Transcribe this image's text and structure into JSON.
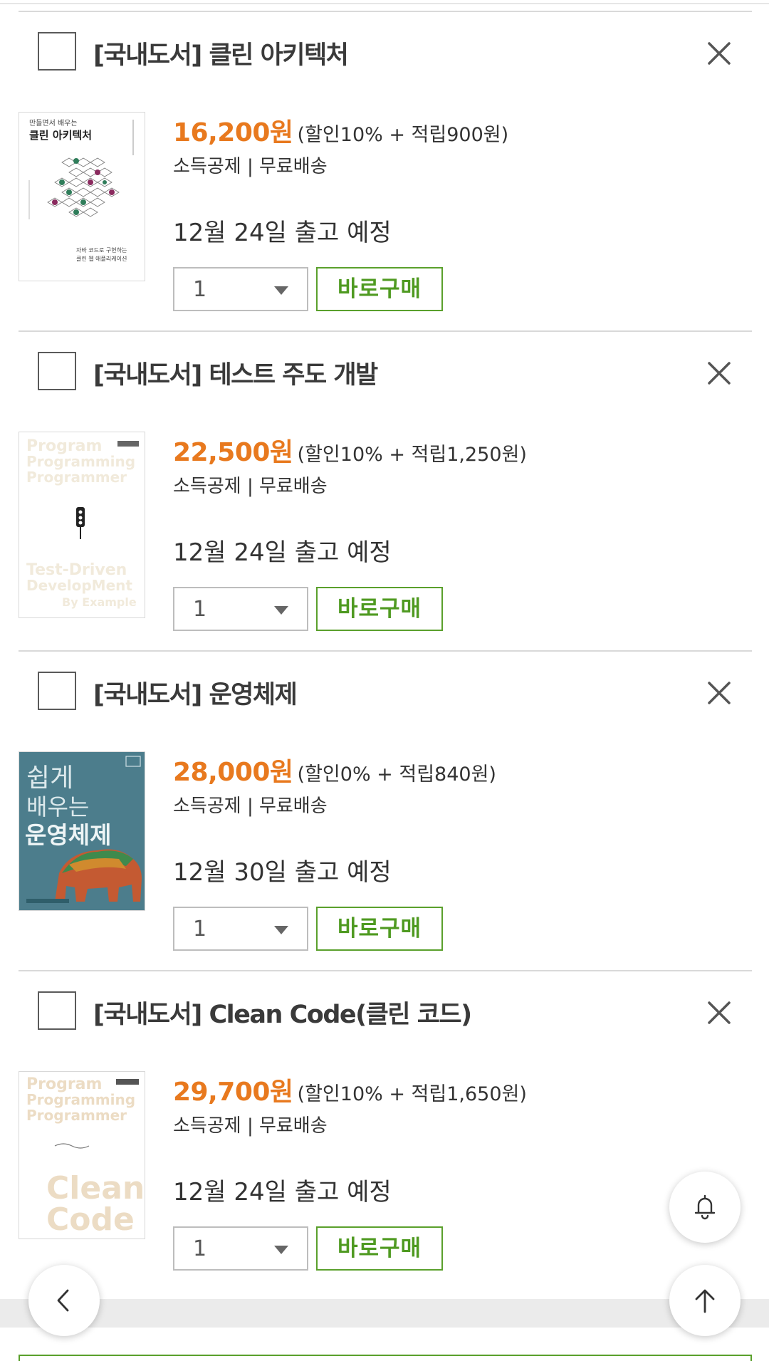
{
  "common": {
    "shipping_label": "소득공제 | 무료배송",
    "buy_label": "바로구매"
  },
  "items": [
    {
      "title": "[국내도서] 클린 아키텍처",
      "price": "16,200원",
      "benefit": "(할인10% + 적립900원)",
      "delivery": "12월 24일 출고 예정",
      "quantity": "1",
      "cover": {
        "top_text": "만들면서 배우는",
        "title_text": "클린 아키텍처",
        "bottom_text1": "자바 코드로 구현하는",
        "bottom_text2": "클린 웹 애플리케이션"
      }
    },
    {
      "title": "[국내도서] 테스트 주도 개발",
      "price": "22,500원",
      "benefit": "(할인10% + 적립1,250원)",
      "delivery": "12월 24일 출고 예정",
      "quantity": "1",
      "cover": {
        "top_text1": "Program",
        "top_text2": "Programming",
        "top_text3": "Programmer",
        "bottom_text1": "Test-Driven",
        "bottom_text2": "DevelopMent",
        "bottom_text3": "By Example"
      }
    },
    {
      "title": "[국내도서] 운영체제",
      "price": "28,000원",
      "benefit": "(할인0% + 적립840원)",
      "delivery": "12월 30일 출고 예정",
      "quantity": "1",
      "cover": {
        "line1": "쉽게",
        "line2": "배우는",
        "line3": "운영체제"
      }
    },
    {
      "title": "[국내도서] Clean Code(클린 코드)",
      "price": "29,700원",
      "benefit": "(할인10% + 적립1,650원)",
      "delivery": "12월 24일 출고 예정",
      "quantity": "1",
      "cover": {
        "top_text1": "Program",
        "top_text2": "Programming",
        "top_text3": "Programmer",
        "bottom_text1": "Clean",
        "bottom_text2": "Code"
      }
    }
  ],
  "colors": {
    "price": "#e8791e",
    "buy_green": "#4f9a21",
    "os_cover_bg": "#4c7d8c"
  },
  "icons": {
    "remove": "close-icon",
    "notify": "bell-icon",
    "back": "chevron-left-icon",
    "top": "arrow-up-icon"
  }
}
